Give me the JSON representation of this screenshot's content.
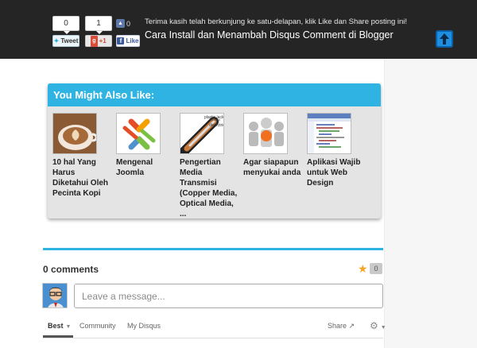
{
  "share_bar": {
    "tweet_count": "0",
    "tweet_label": "Tweet",
    "gplus_count": "1",
    "gplus_label": "+1",
    "fb_like_count": "0",
    "fb_like_label": "Like",
    "message": "Terima kasih telah berkunjung ke satu-delapan, klik Like dan Share posting ini!",
    "post_title": "Cara Install dan Menambah Disqus Comment di Blogger"
  },
  "you_might_also_like": {
    "heading": "You Might Also Like:",
    "items": [
      {
        "title": "10 hal Yang Harus Diketahui Oleh Pecinta Kopi",
        "icon": "coffee-cup-thumbnail"
      },
      {
        "title": "Mengenal Joomla",
        "icon": "joomla-logo-thumbnail"
      },
      {
        "title": "Pengertian Media Transmisi (Copper Media, Optical Media, ...",
        "icon": "coaxial-cable-thumbnail"
      },
      {
        "title": "Agar siapapun menyukai anda",
        "icon": "people-group-thumbnail"
      },
      {
        "title": "Aplikasi Wajib untuk Web Design",
        "icon": "code-editor-thumbnail"
      }
    ]
  },
  "comments": {
    "count_label": "0 comments",
    "recommend_count": "0",
    "input_placeholder": "Leave a message...",
    "tabs": [
      "Best",
      "Community",
      "My Disqus"
    ],
    "share_label": "Share"
  },
  "colors": {
    "accent": "#2fb3e2",
    "topbar": "#252525",
    "star": "#f5a623"
  }
}
